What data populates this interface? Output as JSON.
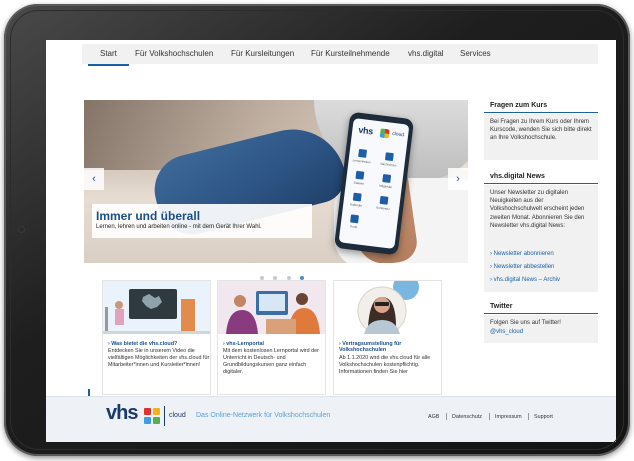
{
  "nav": {
    "items": [
      "Start",
      "Für Volkshochschulen",
      "Für Kursleitungen",
      "Für Kursteilnehmende",
      "vhs.digital",
      "Services"
    ],
    "active_index": 0
  },
  "hero": {
    "title": "Immer und überall",
    "subtitle": "Lernen, lehren und arbeiten online - mit dem Gerät Ihrer Wahl.",
    "prev_icon": "chevron-left-icon",
    "next_icon": "chevron-right-icon",
    "prev_glyph": "‹",
    "next_glyph": "›",
    "slide_count": 4,
    "active_slide": 4,
    "phone_logo": "vhs",
    "phone_cloud": "cloud",
    "phone_tiles": [
      "Lerneinheiten",
      "Nachrichten",
      "Dateien",
      "Mitglieder",
      "Kalender",
      "Konferenz"
    ],
    "phone_bottom": "Profil"
  },
  "cards": [
    {
      "title": "› Was bietet die vhs.cloud?",
      "text": "Entdecken Sie in unserem Video die vielfältigen Möglichkeiten der vhs.cloud für Mitarbeiter*innen und Kursleiter*innen!"
    },
    {
      "title": "› vhs-Lernportal",
      "text": "Mit dem kostenlosen Lernportal wird der Unterricht in Deutsch- und Grundbildungskursen ganz einfach digitaler."
    },
    {
      "title": "› Vertragsumstellung für Volkshochschulen",
      "text": "Ab 1.1.2020 wird die vhs.cloud für alle Volkshochschulen kostenpflichtig. Informationen finden Sie hier"
    }
  ],
  "sidebar": {
    "course": {
      "heading": "Fragen zum Kurs",
      "text": "Bei Fragen zu Ihrem Kurs oder Ihrem Kurscode, wenden Sie sich bitte direkt an Ihre Volkshochschule."
    },
    "news": {
      "heading": "vhs.digital News",
      "text": "Unser Newsletter zu digitalen Neuigkeiten aus der Volkshochschulwelt erscheint jeden zweiten Monat. Abonnieren Sie den Newsletter vhs.digital News:",
      "links": [
        "› Newsletter abonnieren",
        "› Newsletter abbestellen",
        "› vhs.digital News – Archiv"
      ]
    },
    "twitter": {
      "heading": "Twitter",
      "text": "Folgen Sie uns auf Twitter!",
      "handle": "@vhs_cloud"
    }
  },
  "footer": {
    "logo": "vhs",
    "cloud": "cloud",
    "tagline": "Das Online-Netzwerk für Volkshochschulen",
    "links": [
      "AGB",
      "Datenschutz",
      "Impressum",
      "Support"
    ]
  },
  "colors": {
    "accent": "#1b5fa8",
    "brand_dark": "#1b3a6b",
    "tagline": "#5a9fd6",
    "logo_red": "#e0312c",
    "logo_yellow": "#f3b21b",
    "logo_blue": "#3aa0dc",
    "logo_green": "#5ab14a"
  }
}
